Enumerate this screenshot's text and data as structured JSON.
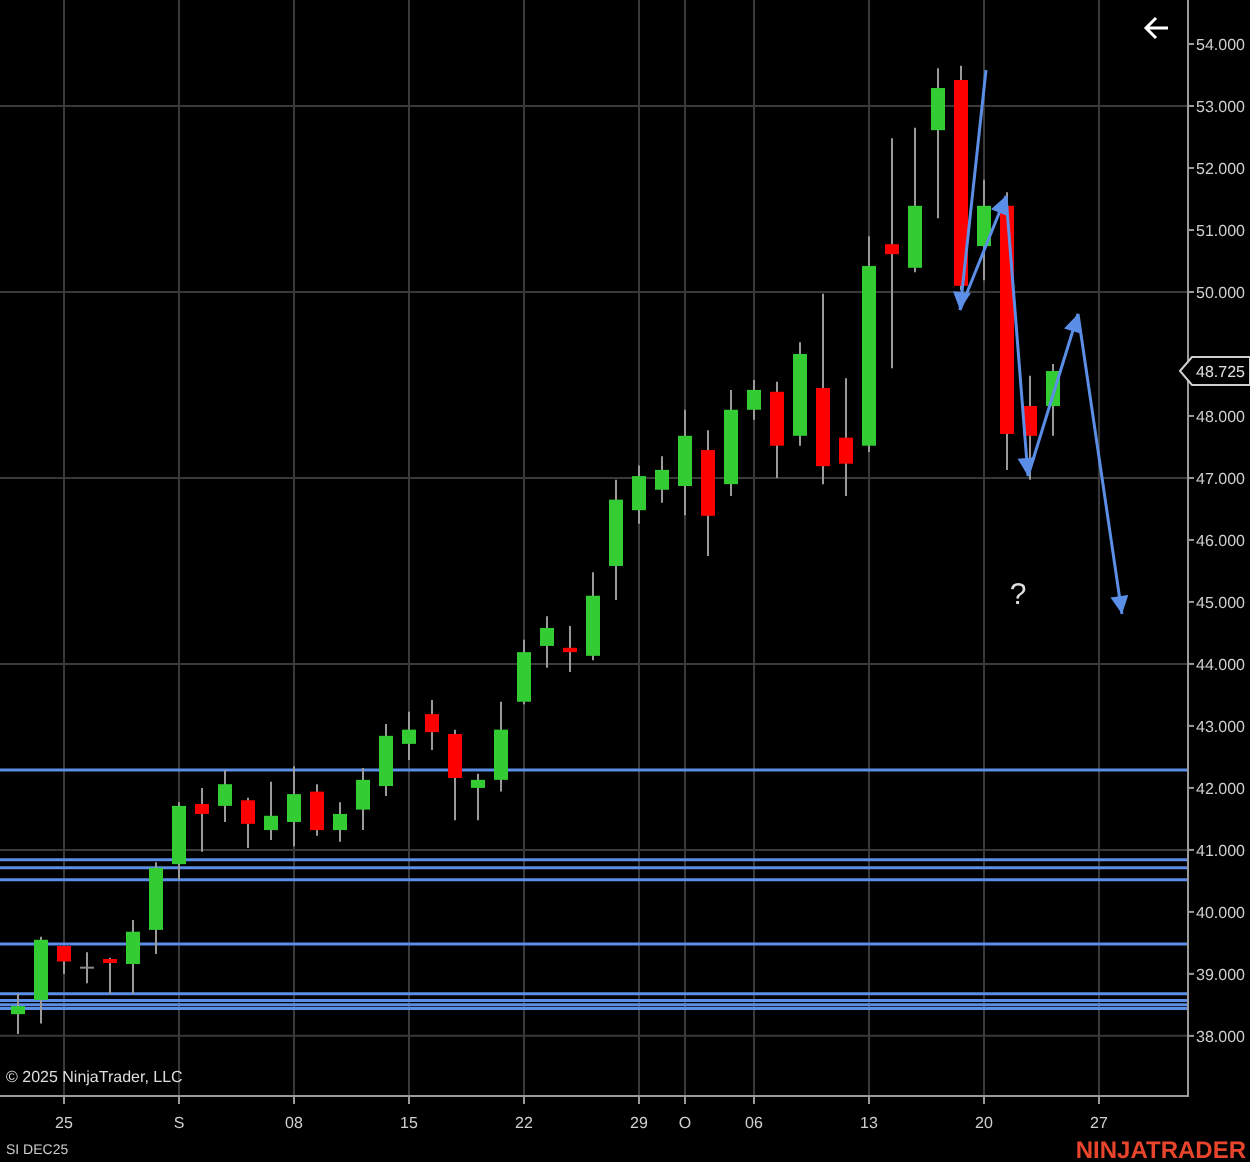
{
  "chart": {
    "chart_data": {
      "type": "candlestick",
      "categories": [
        null,
        null,
        "25",
        null,
        null,
        null,
        null,
        "S",
        null,
        null,
        null,
        null,
        "08",
        null,
        null,
        null,
        null,
        "15",
        null,
        null,
        null,
        null,
        "22",
        null,
        null,
        null,
        null,
        "29",
        null,
        "O",
        null,
        null,
        "06",
        null,
        null,
        null,
        null,
        "13",
        null,
        null,
        null,
        null,
        "20",
        null,
        null,
        null,
        null,
        "27"
      ],
      "ohlc": [
        [
          38.35,
          38.68,
          38.03,
          38.48
        ],
        [
          38.58,
          39.6,
          38.2,
          39.55
        ],
        [
          39.45,
          39.45,
          39.0,
          39.2
        ],
        [
          39.1,
          39.35,
          38.85,
          39.1
        ],
        [
          39.24,
          39.26,
          38.68,
          39.22
        ],
        [
          39.16,
          39.87,
          38.68,
          39.68
        ],
        [
          39.71,
          40.8,
          39.32,
          40.71
        ],
        [
          40.77,
          41.77,
          40.52,
          41.71
        ],
        [
          41.74,
          42.0,
          40.97,
          41.58
        ],
        [
          41.71,
          42.29,
          41.45,
          42.06
        ],
        [
          41.8,
          41.84,
          41.03,
          41.42
        ],
        [
          41.32,
          42.1,
          41.16,
          41.55
        ],
        [
          41.45,
          42.35,
          41.06,
          41.9
        ],
        [
          41.94,
          42.06,
          41.23,
          41.32
        ],
        [
          41.32,
          41.77,
          41.13,
          41.58
        ],
        [
          41.65,
          42.32,
          41.32,
          42.13
        ],
        [
          42.03,
          43.03,
          41.87,
          42.84
        ],
        [
          42.71,
          43.23,
          42.45,
          42.94
        ],
        [
          43.19,
          43.42,
          42.61,
          42.9
        ],
        [
          42.87,
          42.94,
          41.48,
          42.16
        ],
        [
          42.0,
          42.23,
          41.48,
          42.13
        ],
        [
          42.13,
          43.39,
          41.94,
          42.94
        ],
        [
          43.39,
          44.39,
          43.35,
          44.19
        ],
        [
          44.29,
          44.77,
          43.94,
          44.58
        ],
        [
          44.26,
          44.61,
          43.87,
          44.19
        ],
        [
          44.13,
          45.48,
          44.06,
          45.1
        ],
        [
          45.58,
          46.97,
          45.03,
          46.65
        ],
        [
          46.48,
          47.2,
          46.26,
          47.03
        ],
        [
          46.81,
          47.35,
          46.6,
          47.13
        ],
        [
          46.87,
          48.1,
          46.4,
          47.68
        ],
        [
          47.45,
          47.77,
          45.74,
          46.39
        ],
        [
          46.9,
          48.42,
          46.71,
          48.1
        ],
        [
          48.1,
          48.58,
          47.94,
          48.42
        ],
        [
          48.39,
          48.55,
          47.0,
          47.52
        ],
        [
          47.68,
          49.19,
          47.52,
          49.0
        ],
        [
          48.45,
          49.97,
          46.9,
          47.19
        ],
        [
          47.65,
          48.61,
          46.71,
          47.23
        ],
        [
          47.52,
          50.9,
          47.42,
          50.42
        ],
        [
          50.77,
          52.48,
          48.77,
          50.61
        ],
        [
          50.39,
          52.65,
          50.32,
          51.39
        ],
        [
          52.61,
          53.61,
          51.19,
          53.29
        ],
        [
          53.42,
          53.65,
          50.03,
          50.1
        ],
        [
          50.74,
          51.81,
          50.19,
          51.39
        ],
        [
          51.39,
          51.61,
          47.13,
          47.71
        ],
        [
          48.16,
          48.65,
          46.97,
          47.68
        ],
        [
          48.16,
          48.84,
          47.68,
          48.725
        ],
        null,
        null
      ],
      "ylim": [
        37.03,
        54.71
      ],
      "grid": true,
      "yticks": [
        {
          "value": 38,
          "label": "38.000"
        },
        {
          "value": 39,
          "label": "39.000"
        },
        {
          "value": 40,
          "label": "40.000"
        },
        {
          "value": 41,
          "label": "41.000"
        },
        {
          "value": 42,
          "label": "42.000"
        },
        {
          "value": 43,
          "label": "43.000"
        },
        {
          "value": 44,
          "label": "44.000"
        },
        {
          "value": 45,
          "label": "45.000"
        },
        {
          "value": 46,
          "label": "46.000"
        },
        {
          "value": 47,
          "label": "47.000"
        },
        {
          "value": 48,
          "label": "48.000"
        },
        {
          "value": 50,
          "label": "50.000"
        },
        {
          "value": 51,
          "label": "51.000"
        },
        {
          "value": 52,
          "label": "52.000"
        },
        {
          "value": 53,
          "label": "53.000"
        },
        {
          "value": 54,
          "label": "54.000"
        }
      ],
      "ref_lines": [
        {
          "axis": "y",
          "value": 42.29
        },
        {
          "axis": "y",
          "value": 40.84
        },
        {
          "axis": "y",
          "value": 40.71
        },
        {
          "axis": "y",
          "value": 40.52
        },
        {
          "axis": "y",
          "value": 39.48
        },
        {
          "axis": "y",
          "value": 38.68
        },
        {
          "axis": "y",
          "value": 38.57
        },
        {
          "axis": "y",
          "value": 38.5
        },
        {
          "axis": "y",
          "value": 38.44
        }
      ],
      "annotations": [
        "?"
      ]
    },
    "last_price": "48.725"
  },
  "copyright": "© 2025 NinjaTrader, LLC",
  "instrument": "SI DEC25",
  "logo": "NINJATRADER"
}
